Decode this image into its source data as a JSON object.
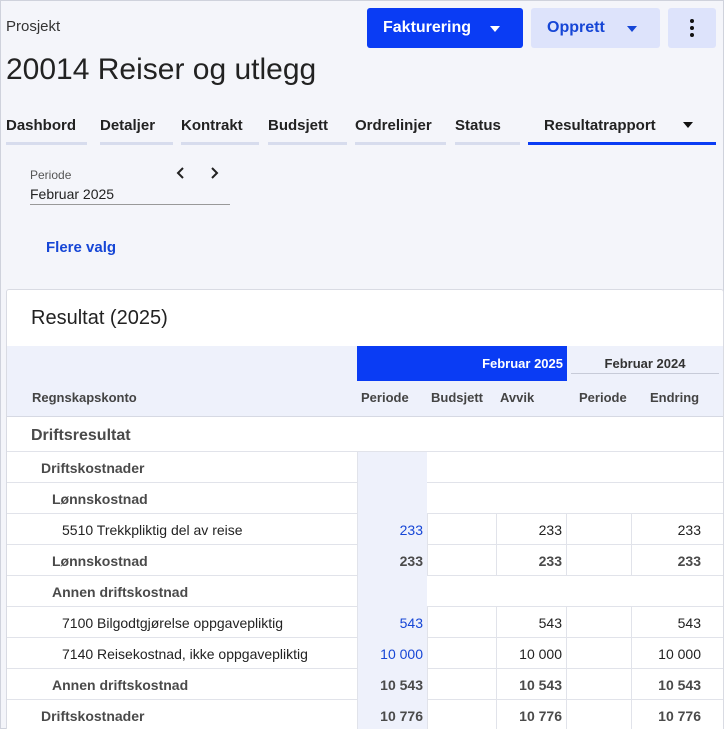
{
  "header": {
    "breadcrumb": "Prosjekt",
    "title": "20014 Reiser og utlegg",
    "buttons": {
      "fakturering": "Fakturering",
      "opprett": "Opprett"
    }
  },
  "tabs": [
    {
      "label": "Dashbord"
    },
    {
      "label": "Detaljer"
    },
    {
      "label": "Kontrakt"
    },
    {
      "label": "Budsjett"
    },
    {
      "label": "Ordrelinjer"
    },
    {
      "label": "Status"
    },
    {
      "label": "Resultatrapport"
    }
  ],
  "filter": {
    "periode_label": "Periode",
    "periode_value": "Februar 2025",
    "more_options": "Flere valg"
  },
  "report": {
    "title": "Resultat (2025)",
    "group_current": "Februar 2025",
    "group_previous": "Februar 2024",
    "columns": {
      "account": "Regnskapskonto",
      "periode": "Periode",
      "budsjett": "Budsjett",
      "avvik": "Avvik",
      "periode_prev": "Periode",
      "endring": "Endring"
    },
    "rows": [
      {
        "label": "Driftsresultat",
        "level": 0,
        "bold": true,
        "periode": "",
        "avvik": "",
        "endring": ""
      },
      {
        "label": "Driftskostnader",
        "level": 1,
        "bold": true,
        "periode": "",
        "avvik": "",
        "endring": ""
      },
      {
        "label": "Lønnskostnad",
        "level": 2,
        "bold": true,
        "periode": "",
        "avvik": "",
        "endring": ""
      },
      {
        "label": "5510 Trekkpliktig del av reise",
        "level": 3,
        "bold": false,
        "periode": "233",
        "avvik": "233",
        "endring": "233"
      },
      {
        "label": "Lønnskostnad",
        "level": 2,
        "bold": true,
        "periode": "233",
        "avvik": "233",
        "endring": "233"
      },
      {
        "label": "Annen driftskostnad",
        "level": 2,
        "bold": true,
        "periode": "",
        "avvik": "",
        "endring": ""
      },
      {
        "label": "7100 Bilgodtgjørelse oppgavepliktig",
        "level": 3,
        "bold": false,
        "periode": "543",
        "avvik": "543",
        "endring": "543"
      },
      {
        "label": "7140 Reisekostnad, ikke oppgavepliktig",
        "level": 3,
        "bold": false,
        "periode": "10 000",
        "avvik": "10 000",
        "endring": "10 000"
      },
      {
        "label": "Annen driftskostnad",
        "level": 2,
        "bold": true,
        "periode": "10 543",
        "avvik": "10 543",
        "endring": "10 543"
      },
      {
        "label": "Driftskostnader",
        "level": 1,
        "bold": true,
        "periode": "10 776",
        "avvik": "10 776",
        "endring": "10 776"
      }
    ]
  },
  "colors": {
    "primary": "#0a3cf4",
    "secondary_bg": "#dde3fb",
    "link": "#1646d6"
  }
}
